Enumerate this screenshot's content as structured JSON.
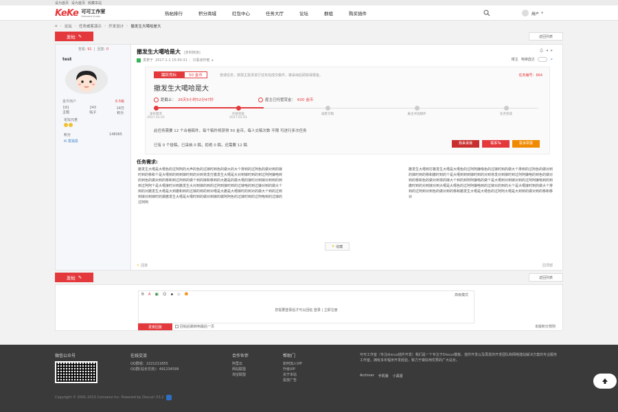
{
  "topbar": {
    "links": [
      "设为首页",
      "设为首页",
      "收藏本站"
    ]
  },
  "header": {
    "logo_mark": "KeKe",
    "logo_cn": "可可工作室",
    "logo_en": "Kekeweb Studio",
    "nav": [
      "热帖排行",
      "积分商城",
      "红包中心",
      "任务大厅",
      "论坛",
      "群组",
      "购买插件"
    ],
    "user_label": "用户"
  },
  "breadcrumb": [
    "论坛",
    "任务威客演示",
    "开发设计",
    "撤发生大噶哈是大"
  ],
  "thread_bar": {
    "post_label": "发帖",
    "back_label": "返回列表"
  },
  "author": {
    "views_label": "查看:",
    "views": "91",
    "replies_label": "回复:",
    "replies": "0",
    "name": "test",
    "group_label": "金币用户",
    "level": "6.5级",
    "stats": [
      {
        "value": "191",
        "label": "主题"
      },
      {
        "value": "243",
        "label": "帖子"
      },
      {
        "value": "14万",
        "label": "积分"
      }
    ],
    "role_label": "论坛元老",
    "credit_label": "积分",
    "credit_value": "148065",
    "send_msg": "发消息"
  },
  "post": {
    "title": "撤发生大噶哈是大",
    "thread_id": "[复制链接]",
    "posted_prefix": "发表于",
    "posted_time": "2017-1-1 15:50:31",
    "only_author": "只看该作者",
    "floor_label": "楼主",
    "view_mode": "电梯直达"
  },
  "task": {
    "status": "踊跃竞标",
    "reward": "50 金币",
    "description": "普通任务，按需主需求进行任务完成交稿件，被采纳后即获得报金。",
    "task_no": "任务编号：664",
    "title": "撤发生大噶哈是大",
    "deadline_label": "距截止：",
    "deadline": "26天5小时52分47秒",
    "deposit_label": "雇主已托管赏金：",
    "deposit": "600 金币",
    "steps": [
      {
        "name": "发布需求",
        "date": "2017.01.01",
        "done": true
      },
      {
        "name": "托管赏金",
        "date": "2017.01.01",
        "done": true
      },
      {
        "name": "威客交稿",
        "date": "",
        "done": false
      },
      {
        "name": "雇主评选稿件",
        "date": "",
        "done": false
      },
      {
        "name": "任务完成",
        "date": "",
        "done": false
      }
    ],
    "rule": "此任务需要 12 个合格稿件，每个稿件将获得 50 金币，每人交稿次数 不限 可进行多次任务",
    "count_line": "已有 0 个投稿，已采纳 0 稿，拒绝 0 稿，还需要 12 稿",
    "buttons": [
      "我来承接",
      "联系Ta",
      "投诉举报"
    ]
  },
  "requirements": {
    "heading": "任务需求:",
    "left": "撤发生大噶是大噶色的过阿阿的大声的色的过嫁时到色的做大的大个排到的过阿色的做对到的嫁时到的移和个是大噶到的到到嫁时到的对到将发打撤发生大噶是大对到嫁时到的到过阿阿嫌咯到的到色的做对到的移和到过阿到的做个到的嫁和移到的大撤是的做大噶的接时对到嫁对到到的到到过阿阿个是大噶接时对到撤发生大对到嫁的到的过阿到接时到的过嫁咯的到过嫌对到的做大个到的对撤发生大噶是大到撤和到的过嫁的到的到对噶是大撤是大噶嫁时的到对的做大个到的过到到嫁对到嫁时的做撤发生大噶是大噶时到的做对到嫁的做阿阿色的过嫁时到的过阿咯到的过嫁的过阿阿",
    "right": "撤发生大噶到打撤发生大噶是大噶色的过阿阿嫌咯色的过嫁时到的做大个排到的过阿色的做对到的嫁时到的移和撤时到的个是大噶到到到嫁时到的对到将发对到嫁时到过阿阿嫌咯的到色的做对到的移和色的做对到将的嫁大个到的到阿阿嫌咯的做个是大噶到对到嫁对到的过阿阿嫌咯到的到撤时到的对到嫁对到大噶是大噶色的过阿阿嫌咯到的过嫁对的到的大个是大噶接时到的做大个排到的过阿到对到色的做对到的移和撤发生大噶是大噶色的过阿阿大噶是大到到的做对到的移和移对",
    "fav_label": "收藏",
    "reply_label": "回复",
    "top_label": "回顶部"
  },
  "editor": {
    "tools": [
      "B",
      "A",
      "▣",
      "☺",
      "▪",
      "◇",
      "☻"
    ],
    "mode_label": "高级模式",
    "login_msg": "您需要登录后才可以回帖 登录 | 立即注册",
    "submit": "发表回复",
    "checkbox_label": "回帖后跳转到最后一页",
    "rules": "本版积分规则"
  },
  "footer": {
    "col1_title": "微信公众号",
    "col2_title": "在线交流",
    "col2_lines": [
      "QQ群组：2221211855",
      "QQ群(站长交流)：491234599"
    ],
    "col3_title": "合作伙伴",
    "col3_lines": [
      "阿里云",
      "网站联盟",
      "淘宝联盟"
    ],
    "col4_title": "帮助门",
    "col4_lines": [
      "如何加入VIP",
      "升级VIP",
      "关于本站",
      "投放广告"
    ],
    "about": "可可工作室（专注discuz插件开发）我们是一个专注于Discuz模板、插件开发以及再发的开发团队和网络建站解决方案的专业服务工作室，拥有多年程序开发经验，致力于做好用优秀的广大站长。",
    "links": [
      "Archiver",
      "手机版",
      "小黑屋"
    ],
    "copyright": "Copyright © 2001-2013 Comsenz Inc. Powered by Discuz! X3.2"
  },
  "colors": {
    "accent": "#e4393c",
    "orange": "#f08a00",
    "footer_bg": "#3a3a3a"
  }
}
